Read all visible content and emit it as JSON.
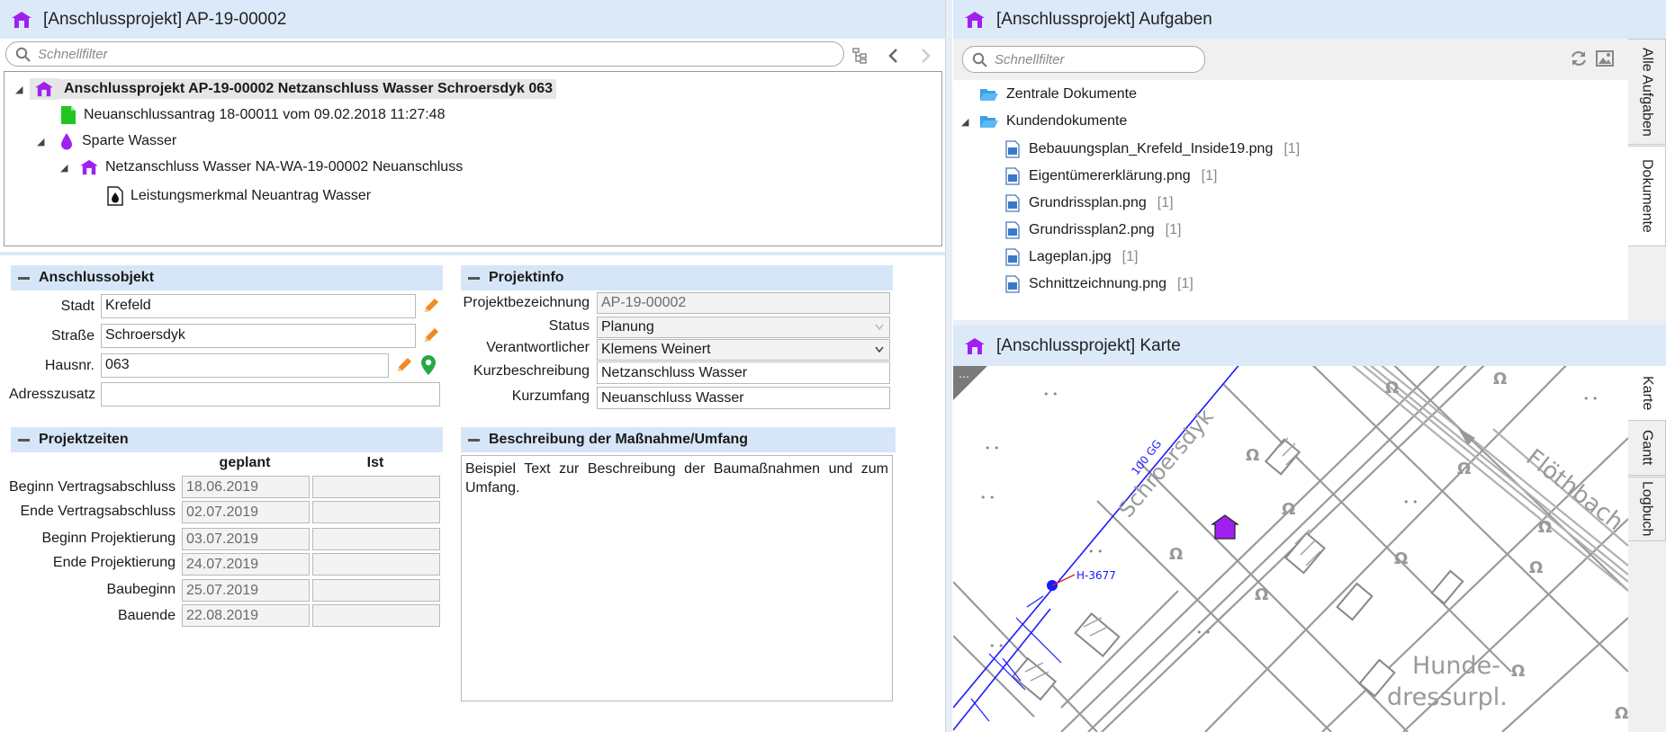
{
  "left_panel": {
    "title": "[Anschlussprojekt] AP-19-00002",
    "search_placeholder": "Schnellfilter",
    "tree": [
      {
        "label": "Anschlussprojekt AP-19-00002 Netzanschluss Wasser Schroersdyk 063",
        "icon": "house-icon"
      },
      {
        "label": "Neuanschlussantrag 18-00011 vom 09.02.2018 11:27:48",
        "icon": "green-document-icon"
      },
      {
        "label": "Sparte Wasser",
        "icon": "water-drop-icon"
      },
      {
        "label": "Netzanschluss Wasser NA-WA-19-00002 Neuanschluss",
        "icon": "house-icon"
      },
      {
        "label": "Leistungsmerkmal Neuantrag Wasser",
        "icon": "drop-document-icon"
      }
    ]
  },
  "anschlussobjekt": {
    "title": "Anschlussobjekt",
    "stadt_label": "Stadt",
    "stadt_value": "Krefeld",
    "strasse_label": "Straße",
    "strasse_value": "Schroersdyk",
    "hausnr_label": "Hausnr.",
    "hausnr_value": "063",
    "adresszusatz_label": "Adresszusatz",
    "adresszusatz_value": ""
  },
  "projektinfo": {
    "title": "Projektinfo",
    "bezeichnung_label": "Projektbezeichnung",
    "bezeichnung_value": "AP-19-00002",
    "status_label": "Status",
    "status_value": "Planung",
    "verantwortlicher_label": "Verantwortlicher",
    "verantwortlicher_value": "Klemens Weinert",
    "kurzbeschreibung_label": "Kurzbeschreibung",
    "kurzbeschreibung_value": "Netzanschluss Wasser",
    "kurzumfang_label": "Kurzumfang",
    "kurzumfang_value": "Neuanschluss Wasser"
  },
  "projektzeiten": {
    "title": "Projektzeiten",
    "col_geplant": "geplant",
    "col_ist": "Ist",
    "rows": [
      {
        "label": "Beginn Vertragsabschluss",
        "geplant": "18.06.2019",
        "ist": ""
      },
      {
        "label": "Ende Vertragsabschluss",
        "geplant": "02.07.2019",
        "ist": ""
      },
      {
        "label": "Beginn Projektierung",
        "geplant": "03.07.2019",
        "ist": ""
      },
      {
        "label": "Ende Projektierung",
        "geplant": "24.07.2019",
        "ist": ""
      },
      {
        "label": "Baubeginn",
        "geplant": "25.07.2019",
        "ist": ""
      },
      {
        "label": "Bauende",
        "geplant": "22.08.2019",
        "ist": ""
      }
    ]
  },
  "beschreibung": {
    "title": "Beschreibung der Maßnahme/Umfang",
    "text": "Beispiel Text zur Beschreibung der Baumaßnahmen und zum Umfang."
  },
  "aufgaben_panel": {
    "title": "[Anschlussprojekt] Aufgaben",
    "search_placeholder": "Schnellfilter",
    "folders": [
      "Zentrale Dokumente",
      "Kundendokumente"
    ],
    "documents": [
      {
        "name": "Bebauungsplan_Krefeld_Inside19.png",
        "count": "[1]"
      },
      {
        "name": "Eigentümererklärung.png",
        "count": "[1]"
      },
      {
        "name": "Grundrissplan.png",
        "count": "[1]"
      },
      {
        "name": "Grundrissplan2.png",
        "count": "[1]"
      },
      {
        "name": "Lageplan.jpg",
        "count": "[1]"
      },
      {
        "name": "Schnittzeichnung.png",
        "count": "[1]"
      }
    ],
    "tabs": [
      "Alle Aufgaben",
      "Dokumente"
    ]
  },
  "karte_panel": {
    "title": "[Anschlussprojekt] Karte",
    "map_labels": {
      "street": "Schroersdyk",
      "pipe": "100 GG",
      "hydrant": "H-3677",
      "creek": "Flöthbach",
      "area1": "Hunde-",
      "area2": "dressurpl."
    },
    "tabs": [
      "Karte",
      "Gantt",
      "Logbuch"
    ]
  },
  "colors": {
    "header_bg": "#dbe9f9",
    "section_bg": "#d6e6f8",
    "accent_purple": "#a020f0",
    "pencil_orange": "#f08a1c",
    "pin_green": "#28a745",
    "pipe_blue": "#1a1aff"
  }
}
